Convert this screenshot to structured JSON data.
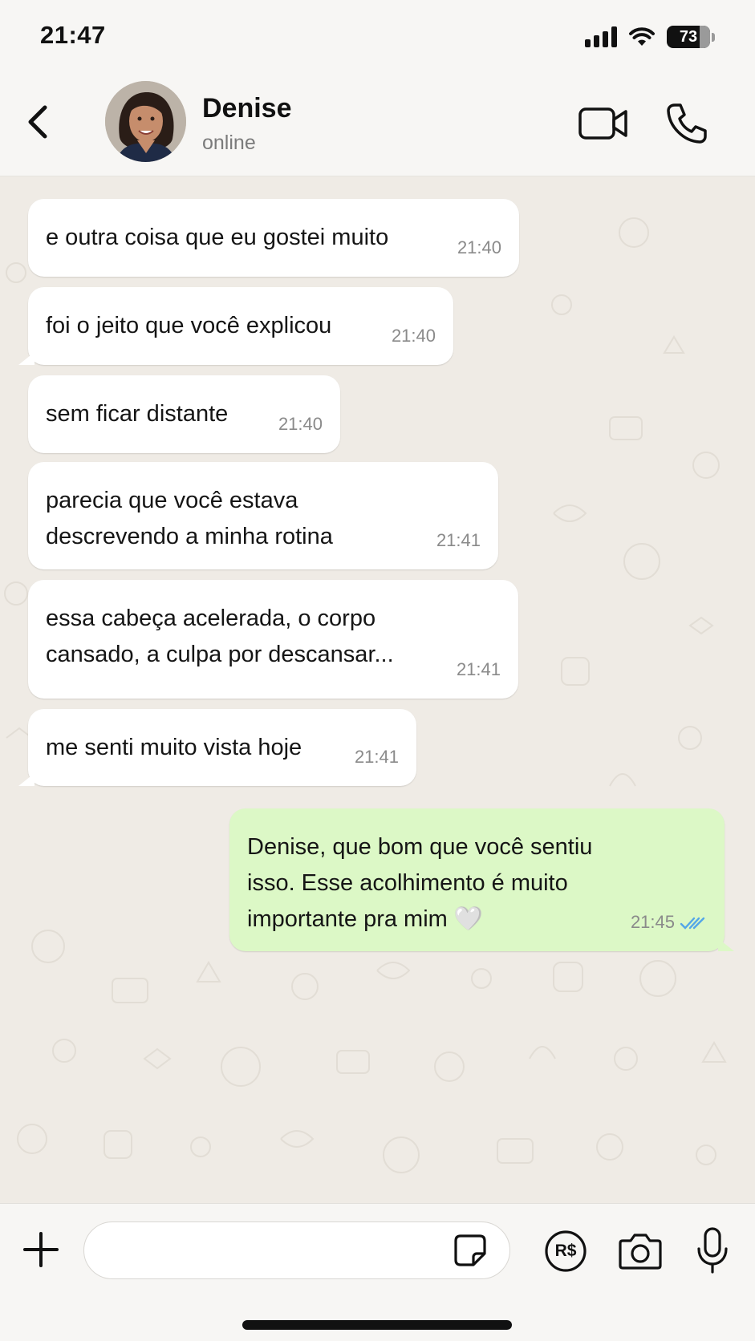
{
  "status_bar": {
    "time": "21:47",
    "battery": "73"
  },
  "header": {
    "contact_name": "Denise",
    "contact_status": "online",
    "back_icon": "chevron-left-icon",
    "video_icon": "video-camera-icon",
    "call_icon": "phone-icon"
  },
  "messages": [
    {
      "direction": "incoming",
      "text": "e outra coisa que eu gostei muito",
      "time": "21:40"
    },
    {
      "direction": "incoming",
      "text": "foi o jeito que você explicou",
      "time": "21:40"
    },
    {
      "direction": "incoming",
      "text": "sem ficar distante",
      "time": "21:40"
    },
    {
      "direction": "incoming",
      "text": "parecia que você estava\ndescrevendo a minha rotina",
      "time": "21:41"
    },
    {
      "direction": "incoming",
      "text": "essa cabeça acelerada, o corpo\ncansado, a culpa por descansar...",
      "time": "21:41"
    },
    {
      "direction": "incoming",
      "text": "me senti muito vista hoje",
      "time": "21:41"
    },
    {
      "direction": "outgoing",
      "text": "Denise, que bom que você sentiu\nisso. Esse acolhimento é muito\nimportante pra mim",
      "emoji": "🤍",
      "time": "21:45",
      "read": true
    }
  ],
  "input_bar": {
    "value": "",
    "pay_label": "R$",
    "icons": [
      "plus-icon",
      "sticker-icon",
      "pix-payment-icon",
      "camera-icon",
      "microphone-icon"
    ]
  },
  "colors": {
    "outgoing_bubble": "#dcf8c6",
    "incoming_bubble": "#ffffff",
    "chat_background": "#efebe5",
    "read_ticks": "#53a6e8"
  }
}
